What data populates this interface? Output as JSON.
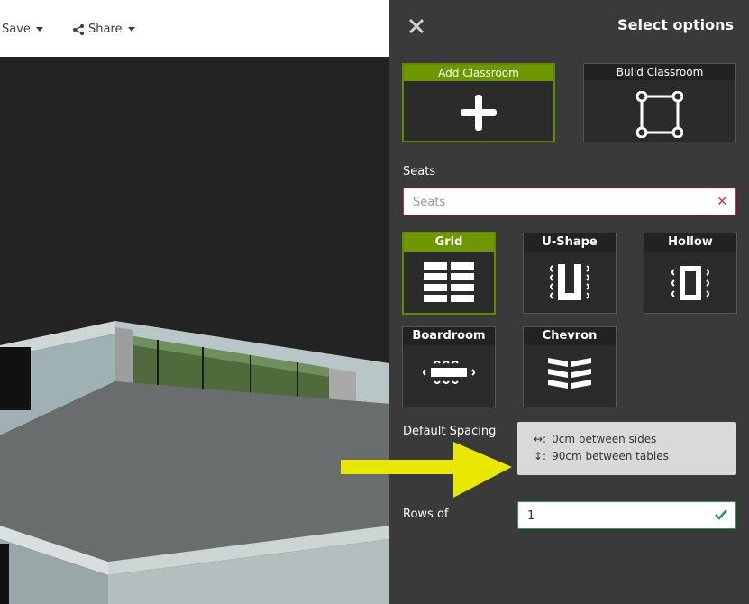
{
  "toolbar": {
    "save_label": "Save",
    "share_label": "Share"
  },
  "panel": {
    "title": "Select options",
    "modes": [
      {
        "label": "Add Classroom",
        "icon": "plus-icon",
        "selected": true
      },
      {
        "label": "Build Classroom",
        "icon": "square-nodes-icon",
        "selected": false
      }
    ],
    "seats": {
      "label": "Seats",
      "placeholder": "Seats",
      "value": ""
    },
    "layouts": [
      {
        "label": "Grid",
        "icon": "grid-layout-icon",
        "selected": true
      },
      {
        "label": "U-Shape",
        "icon": "u-shape-layout-icon",
        "selected": false
      },
      {
        "label": "Hollow",
        "icon": "hollow-layout-icon",
        "selected": false
      },
      {
        "label": "Boardroom",
        "icon": "boardroom-layout-icon",
        "selected": false
      },
      {
        "label": "Chevron",
        "icon": "chevron-layout-icon",
        "selected": false
      }
    ],
    "spacing": {
      "label": "Default Spacing",
      "sides": "0cm between sides",
      "tables": "90cm between tables"
    },
    "rows": {
      "label": "Rows of",
      "value": "1"
    }
  },
  "colors": {
    "accent": "#6d9800",
    "error": "#d7263a",
    "success": "#2e9b4a",
    "arrow": "#e8e800"
  }
}
